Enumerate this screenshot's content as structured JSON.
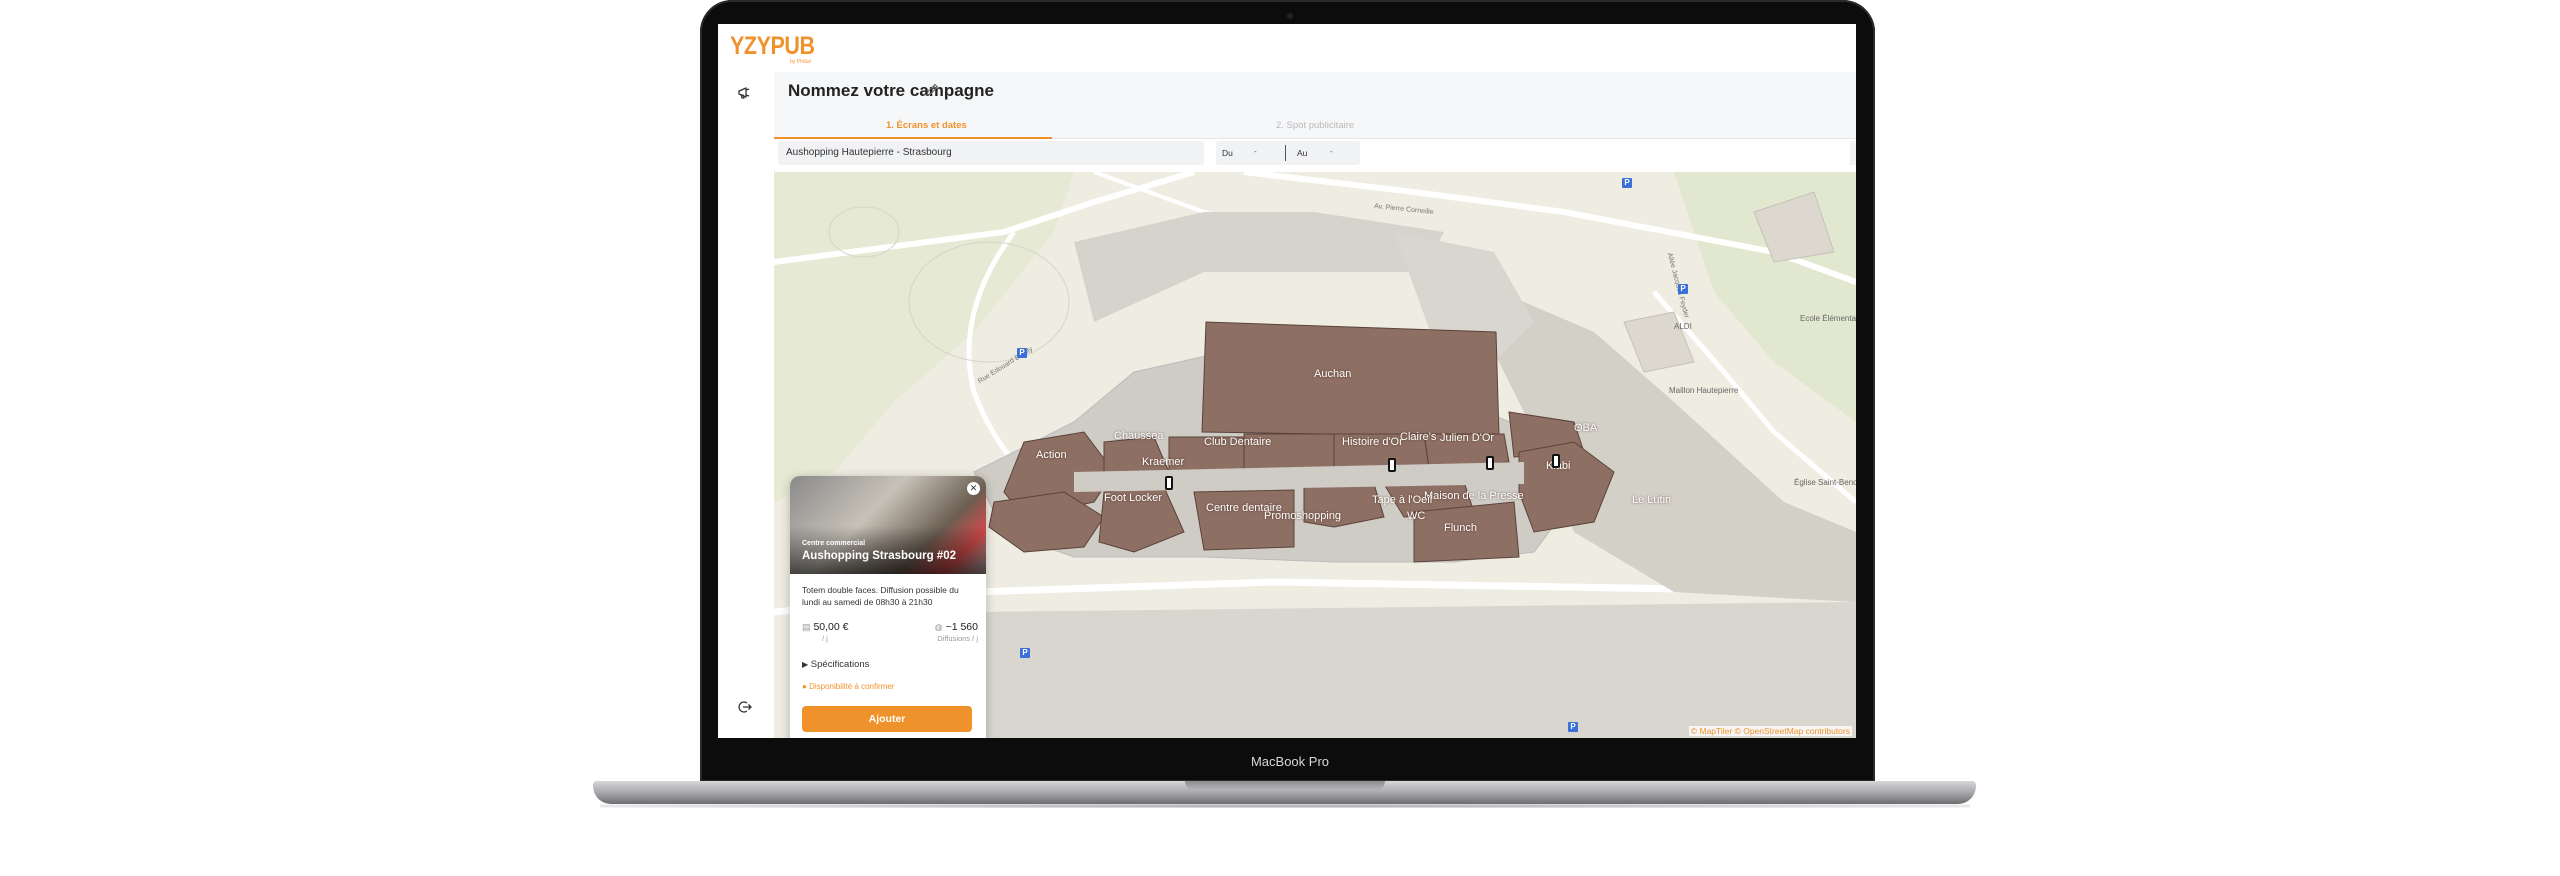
{
  "device": {
    "model_label": "MacBook Pro"
  },
  "brand": {
    "logo_text": "YZYPUB",
    "logo_sub": "by PhiSel",
    "accent": "#f0922b"
  },
  "sidebar": {
    "top_icon": "megaphone-icon",
    "bottom_icon": "logout-icon"
  },
  "header": {
    "campaign_title": "Nommez votre campagne",
    "edit_icon": "pencil-icon"
  },
  "steps": [
    {
      "label": "1. Écrans et dates",
      "active": true
    },
    {
      "label": "2. Spot publicitaire",
      "active": false
    }
  ],
  "filters": {
    "location": "Aushopping Hautepierre - Strasbourg",
    "from_label": "Du",
    "from_value": "-",
    "to_label": "Au",
    "to_value": "-"
  },
  "map": {
    "store_labels": [
      "Auchan",
      "Action",
      "Chaussea",
      "Kiabi",
      "Flunch",
      "Foot Locker",
      "Promoshopping",
      "Claire's",
      "Julien D'Or",
      "Histoire d'Or",
      "Club Dentaire",
      "Maison de la Presse",
      "Le Lutin",
      "Tape à l'Oeil",
      "Centre dentaire",
      "OBA",
      "Kraemer",
      "WC"
    ],
    "street_labels": [
      "Rue Edouard Branly",
      "Av. Pierre Corneille",
      "Allée Jacques Feyder",
      "Maillon Hautepierre",
      "ALDI",
      "Ecole Élémentaire Brigitte",
      "Église Saint-Benoît"
    ],
    "attribution": "© MapTiler © OpenStreetMap contributors"
  },
  "card": {
    "pretitle": "Centre commercial",
    "title": "Aushopping Strasbourg #02",
    "description": "Totem double faces. Diffusion possible du lundi au samedi de 08h30 à 21h30",
    "price": "50,00 €",
    "price_unit": "/ j",
    "diffusions": "~1 560",
    "diffusions_unit": "Diffusions / j",
    "specs_label": "Spécifications",
    "availability": "Disponibilité à confirmer",
    "add_label": "Ajouter"
  }
}
